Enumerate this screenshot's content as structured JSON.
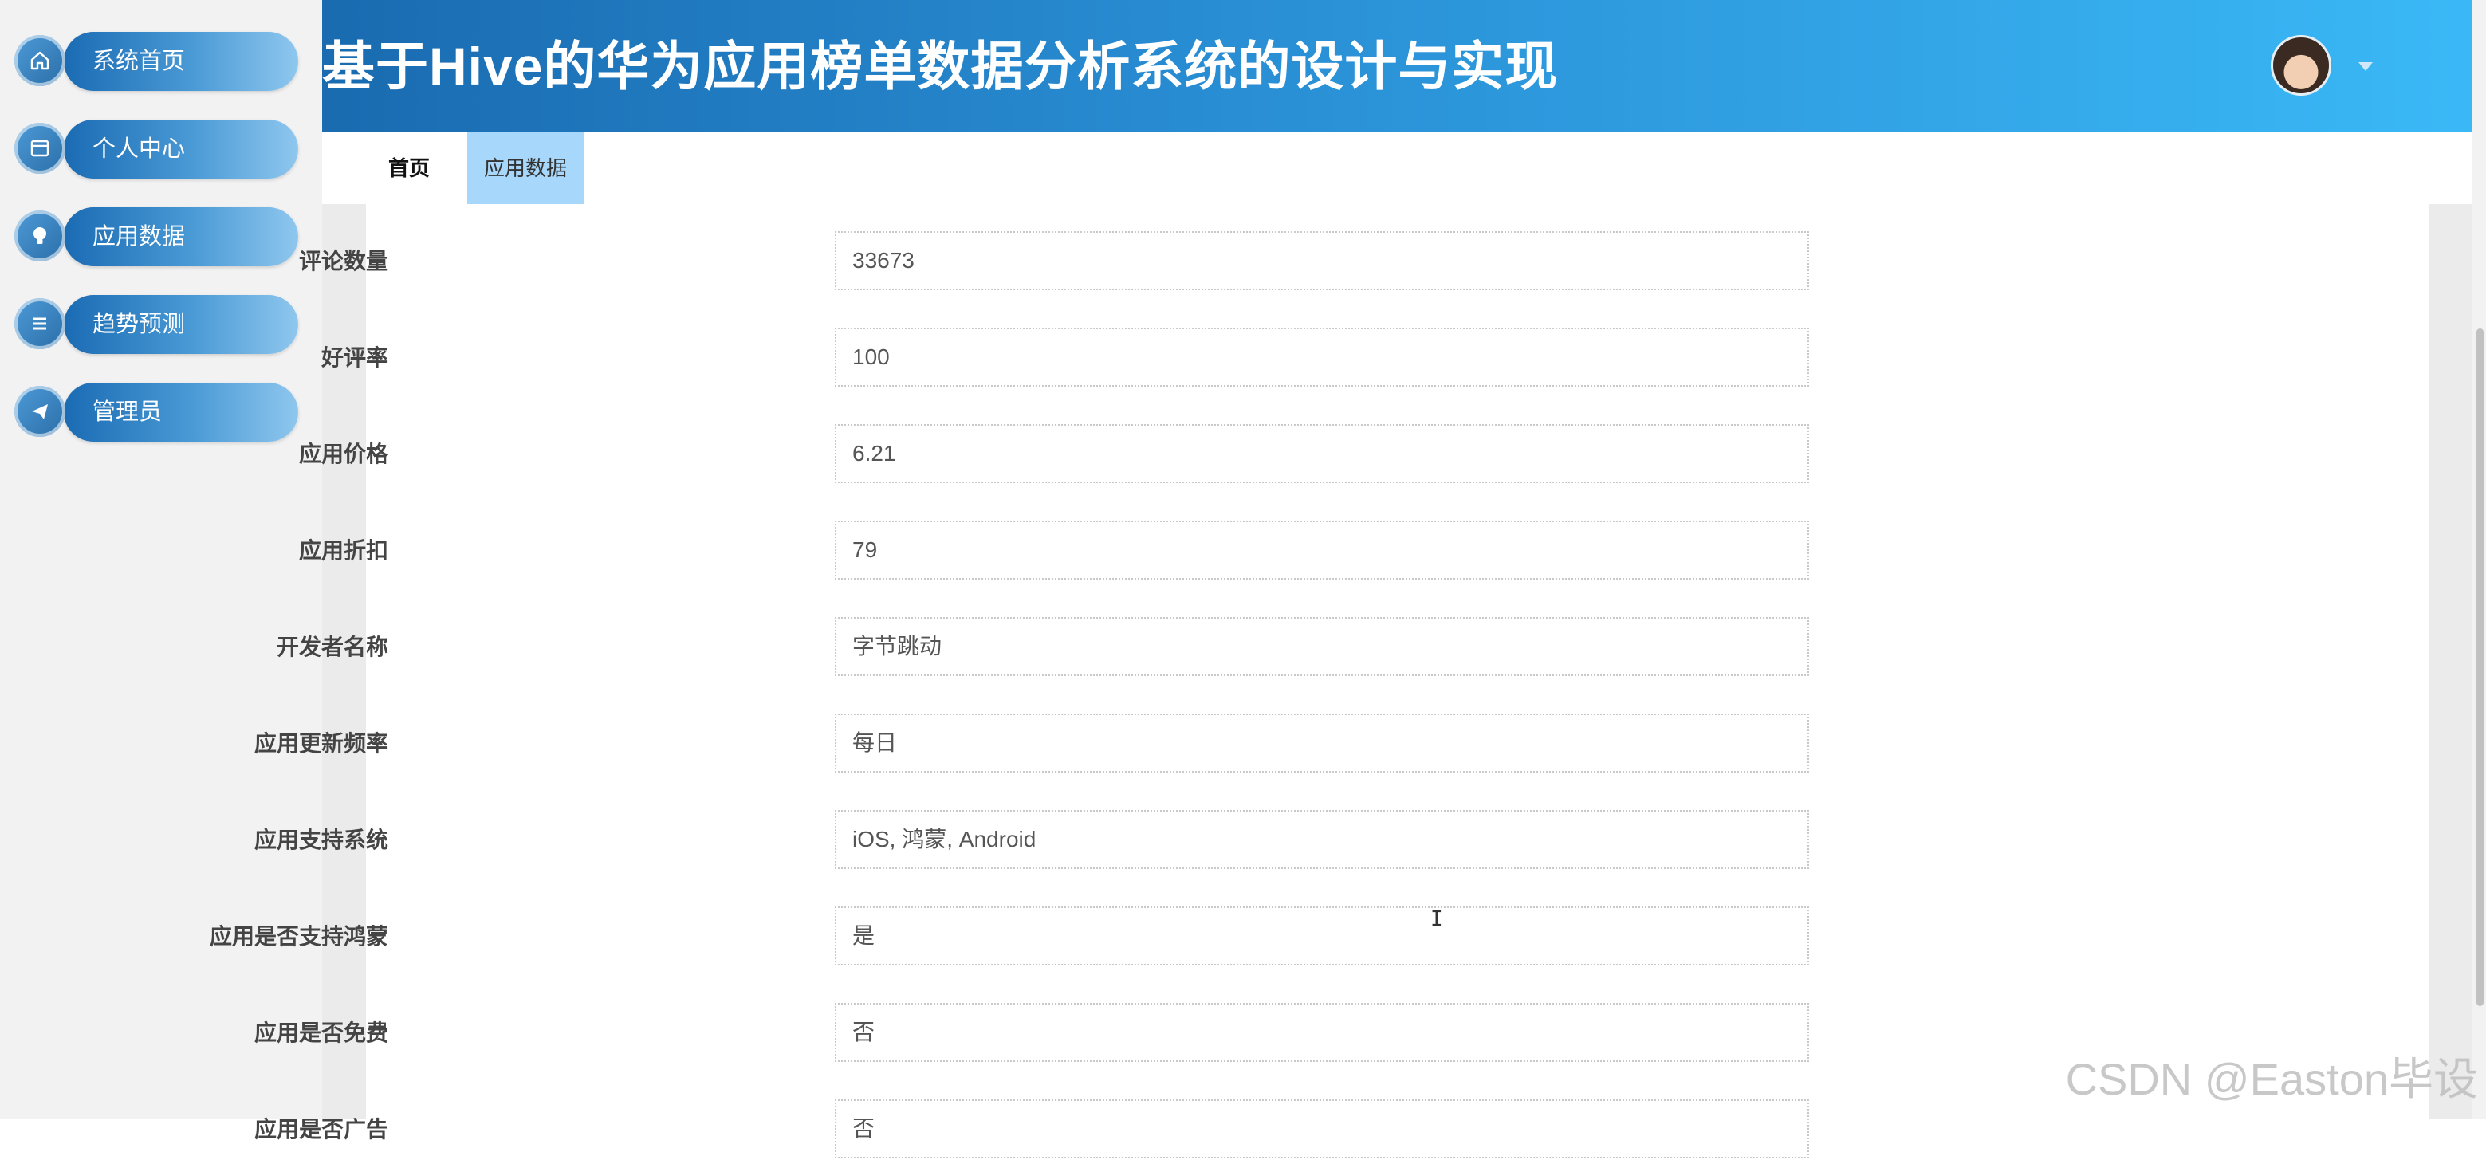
{
  "sidebar": {
    "items": [
      {
        "label": "系统首页",
        "icon": "home-icon"
      },
      {
        "label": "个人中心",
        "icon": "card-icon"
      },
      {
        "label": "应用数据",
        "icon": "bulb-icon"
      },
      {
        "label": "趋势预测",
        "icon": "list-icon"
      },
      {
        "label": "管理员",
        "icon": "send-icon"
      }
    ]
  },
  "header": {
    "title": "基于Hive的华为应用榜单数据分析系统的设计与实现",
    "avatar_icon": "user-avatar",
    "caret_icon": "caret-down-icon"
  },
  "tabs": [
    {
      "label": "首页",
      "active": false
    },
    {
      "label": "应用数据",
      "active": true
    }
  ],
  "form": {
    "fields": [
      {
        "label": "评论数量",
        "value": "33673"
      },
      {
        "label": "好评率",
        "value": "100"
      },
      {
        "label": "应用价格",
        "value": "6.21"
      },
      {
        "label": "应用折扣",
        "value": "79"
      },
      {
        "label": "开发者名称",
        "value": "字节跳动"
      },
      {
        "label": "应用更新频率",
        "value": "每日"
      },
      {
        "label": "应用支持系统",
        "value": "iOS, 鸿蒙, Android"
      },
      {
        "label": "应用是否支持鸿蒙",
        "value": "是"
      },
      {
        "label": "应用是否免费",
        "value": "否"
      },
      {
        "label": "应用是否广告",
        "value": "否"
      }
    ]
  },
  "cursor_glyph": "I",
  "watermark": "CSDN @Easton毕设",
  "colors": {
    "header_start": "#1a6bb0",
    "header_end": "#3ab8f6",
    "active_tab": "#a7d8fb",
    "sidebar_bg": "#f2f2f2"
  }
}
